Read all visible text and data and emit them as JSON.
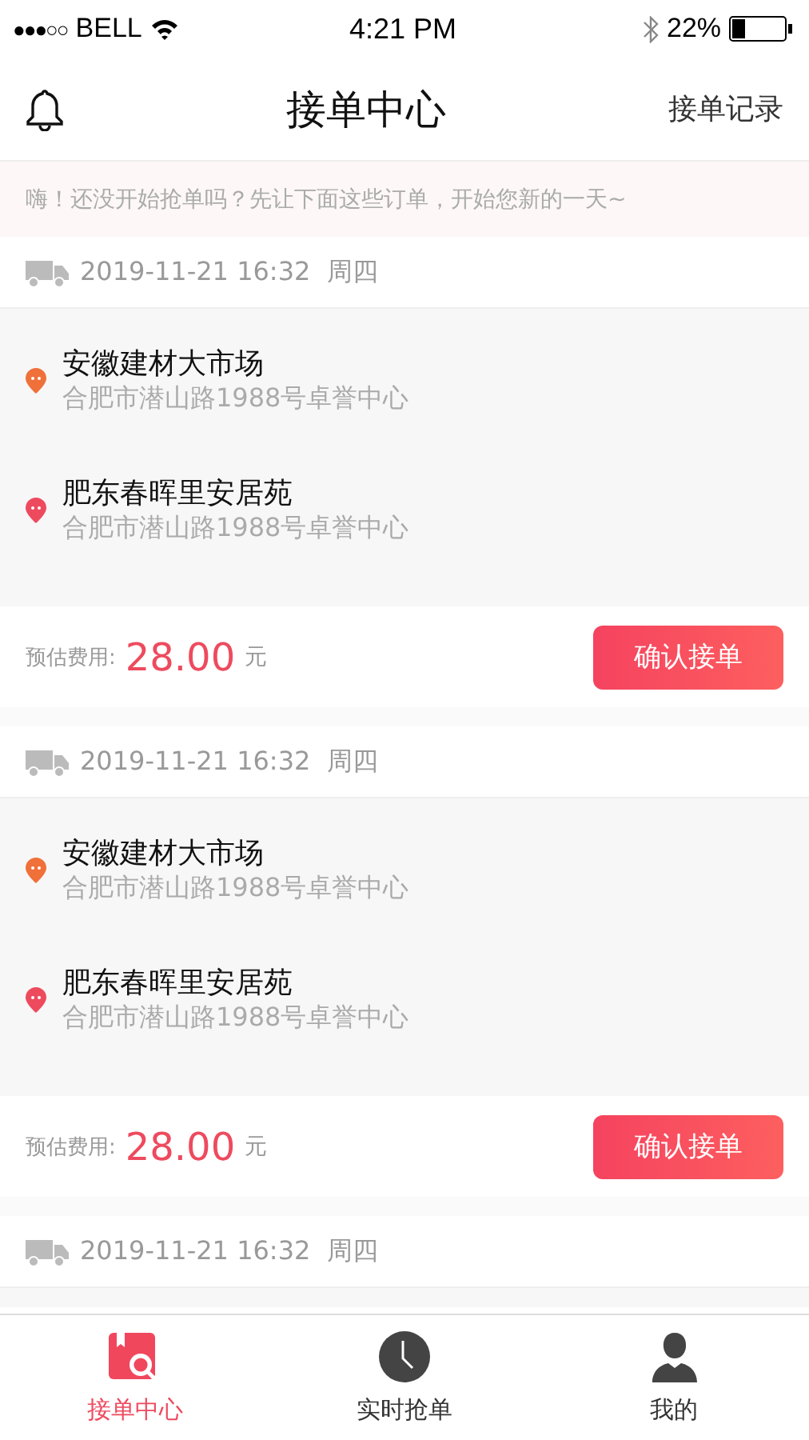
{
  "status_bar": {
    "signal": "●●●○○",
    "carrier": "BELL",
    "time": "4:21 PM",
    "battery": "22%"
  },
  "nav": {
    "title": "接单中心",
    "action": "接单记录"
  },
  "banner": "嗨！还没开始抢单吗？先让下面这些订单，开始您新的一天~",
  "orders": [
    {
      "date": "2019-11-21 16:32",
      "weekday": "周四",
      "stops": [
        {
          "name": "安徽建材大市场",
          "address": "合肥市潜山路1988号卓誉中心",
          "color": "#f0703a"
        },
        {
          "name": "肥东春晖里安居苑",
          "address": "合肥市潜山路1988号卓誉中心",
          "color": "#ee4a5e"
        }
      ],
      "fee_label": "预估费用:",
      "fee": "28.00",
      "unit": "元",
      "button": "确认接单"
    },
    {
      "date": "2019-11-21 16:32",
      "weekday": "周四",
      "stops": [
        {
          "name": "安徽建材大市场",
          "address": "合肥市潜山路1988号卓誉中心",
          "color": "#f0703a"
        },
        {
          "name": "肥东春晖里安居苑",
          "address": "合肥市潜山路1988号卓誉中心",
          "color": "#ee4a5e"
        }
      ],
      "fee_label": "预估费用:",
      "fee": "28.00",
      "unit": "元",
      "button": "确认接单"
    },
    {
      "date": "2019-11-21 16:32",
      "weekday": "周四"
    }
  ],
  "tabs": [
    {
      "label": "接单中心",
      "kind": "search",
      "selected": true
    },
    {
      "label": "实时抢单",
      "kind": "clock",
      "selected": false
    },
    {
      "label": "我的",
      "kind": "person",
      "selected": false
    }
  ]
}
